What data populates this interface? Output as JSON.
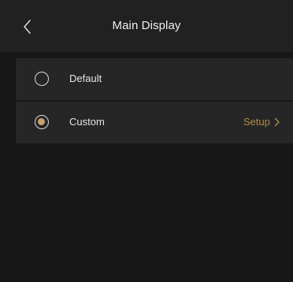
{
  "header": {
    "title": "Main Display",
    "back_icon": "chevron-left-icon"
  },
  "options": [
    {
      "label": "Default",
      "selected": false
    },
    {
      "label": "Custom",
      "selected": true,
      "action_label": "Setup",
      "action_icon": "chevron-right-icon"
    }
  ],
  "colors": {
    "accent": "#b48a4d",
    "selected_radio": "#c7a46b",
    "background": "#171717",
    "row_background": "#262626"
  }
}
